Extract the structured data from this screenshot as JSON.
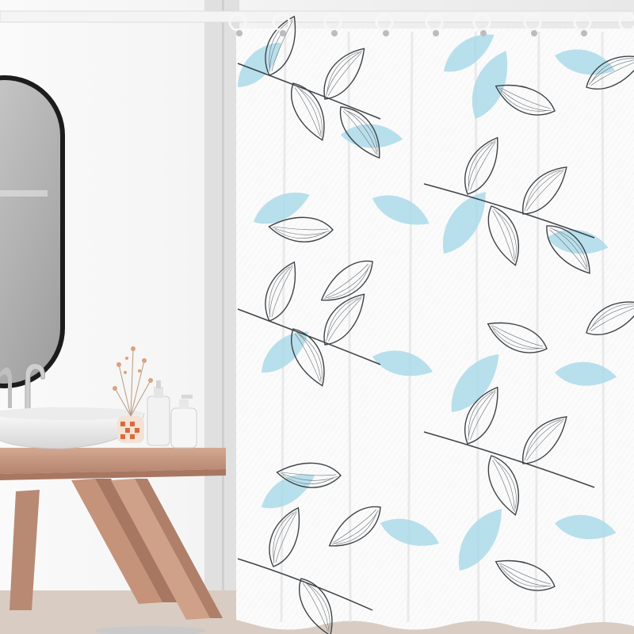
{
  "scene": {
    "description_items": [
      "bathroom",
      "shower-curtain",
      "vanity-shelf",
      "vessel-sink",
      "faucet",
      "mirror",
      "soap-dispenser",
      "bottle",
      "vase",
      "dried-flowers",
      "curtain-rod",
      "curtain-rings"
    ],
    "colors": {
      "wall": "#f1f1f0",
      "wood": "#c4937a",
      "wood_dark": "#a87761",
      "curtain": "#fbfbfb",
      "leaf_blue": "#9fd3e3",
      "leaf_line": "#3e4347",
      "mirror_frame": "#1c1c1c",
      "floor": "#d9ccc2"
    }
  }
}
